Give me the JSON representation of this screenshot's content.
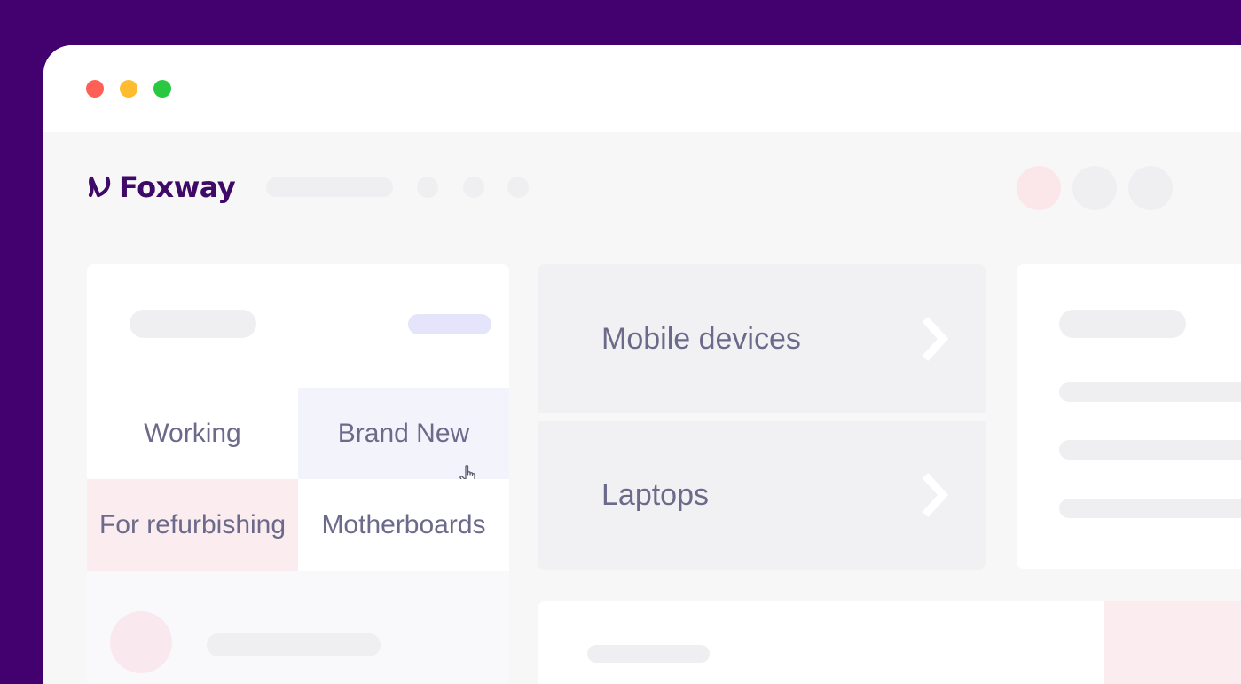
{
  "app": {
    "logo_text": "Foxway"
  },
  "conditions": {
    "working": "Working",
    "brand_new": "Brand New",
    "for_refurbishing": "For refurbishing",
    "motherboards": "Motherboards"
  },
  "categories": [
    {
      "label": "Mobile devices",
      "icon": "chevron-right-icon"
    },
    {
      "label": "Laptops",
      "icon": "chevron-right-icon"
    }
  ],
  "colors": {
    "background": "#43006f",
    "brand": "#3f0a67",
    "selected_cell": "#f3f3fc",
    "refurbishing_cell": "#fbecef",
    "text": "#6c6a8a"
  }
}
